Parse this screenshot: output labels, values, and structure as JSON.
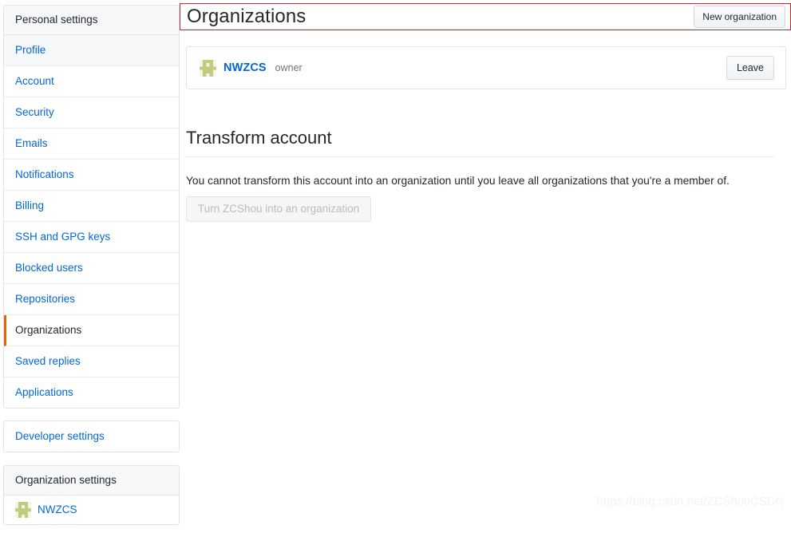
{
  "sidebar": {
    "personal": {
      "header": "Personal settings",
      "items": [
        {
          "label": "Profile",
          "state": "shaded"
        },
        {
          "label": "Account",
          "state": "normal"
        },
        {
          "label": "Security",
          "state": "normal"
        },
        {
          "label": "Emails",
          "state": "normal"
        },
        {
          "label": "Notifications",
          "state": "normal"
        },
        {
          "label": "Billing",
          "state": "normal"
        },
        {
          "label": "SSH and GPG keys",
          "state": "normal"
        },
        {
          "label": "Blocked users",
          "state": "normal"
        },
        {
          "label": "Repositories",
          "state": "normal"
        },
        {
          "label": "Organizations",
          "state": "selected"
        },
        {
          "label": "Saved replies",
          "state": "normal"
        },
        {
          "label": "Applications",
          "state": "normal"
        }
      ]
    },
    "developer": {
      "label": "Developer settings"
    },
    "organization": {
      "header": "Organization settings",
      "items": [
        {
          "label": "NWZCS",
          "avatar": "identicon-avatar"
        }
      ]
    }
  },
  "main": {
    "title": "Organizations",
    "new_org_button": "New organization",
    "org_card": {
      "avatar": "identicon-avatar",
      "name": "NWZCS",
      "role": "owner",
      "leave_button": "Leave"
    },
    "transform": {
      "heading": "Transform account",
      "description": "You cannot transform this account into an organization until you leave all organizations that you're a member of.",
      "button": "Turn ZCShou into an organization"
    }
  },
  "watermark": "https://blog.csdn.net/ZCShouCSDN",
  "colors": {
    "link": "#0366d6",
    "text": "#24292e",
    "muted": "#6a737d",
    "border": "#e1e4e8",
    "header_bg": "#f6f8fa",
    "selected_accent": "#e36209",
    "annotation": "#b03030",
    "identicon": "#c3ca7a"
  }
}
